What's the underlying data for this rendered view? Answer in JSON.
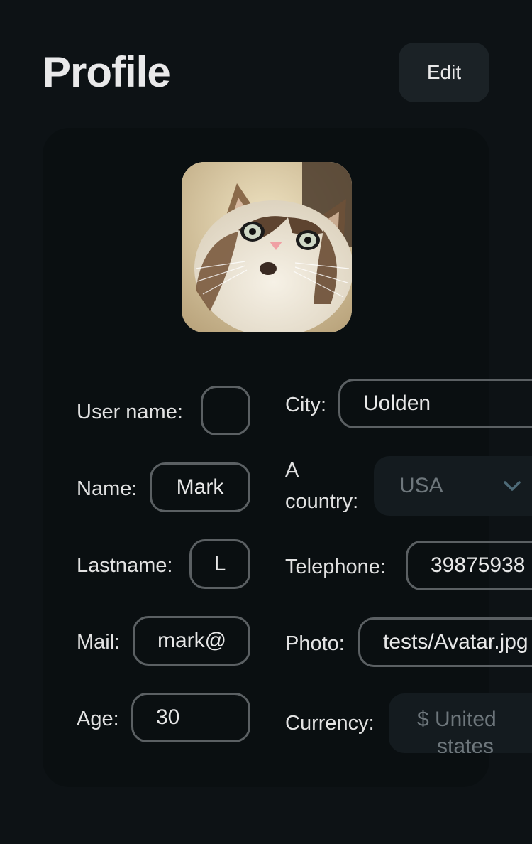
{
  "header": {
    "title": "Profile",
    "edit_label": "Edit"
  },
  "avatar": {
    "icon": "cat-photo"
  },
  "form": {
    "user_name": {
      "label": "User name:",
      "value": ""
    },
    "name": {
      "label": "Name:",
      "value": "Mark"
    },
    "lastname": {
      "label": "Lastname:",
      "value": "L"
    },
    "mail": {
      "label": "Mail:",
      "value": "mark@"
    },
    "age": {
      "label": "Age:",
      "value": "30"
    },
    "city": {
      "label": "City:",
      "value": "Uolden"
    },
    "country": {
      "label_line1": "A",
      "label_line2": "country:",
      "value": "USA"
    },
    "telephone": {
      "label": "Telephone:",
      "value": "39875938"
    },
    "photo": {
      "label": "Photo:",
      "value": "tests/Avatar.jpg"
    },
    "currency": {
      "label": "Currency:",
      "value_line1": "$ United",
      "value_line2": "states"
    }
  },
  "colors": {
    "background": "#0d1215",
    "card": "#0a0f11",
    "field_border": "#5b6063",
    "select_bg": "#141b1f",
    "accent_chevron": "#4e6b78"
  }
}
